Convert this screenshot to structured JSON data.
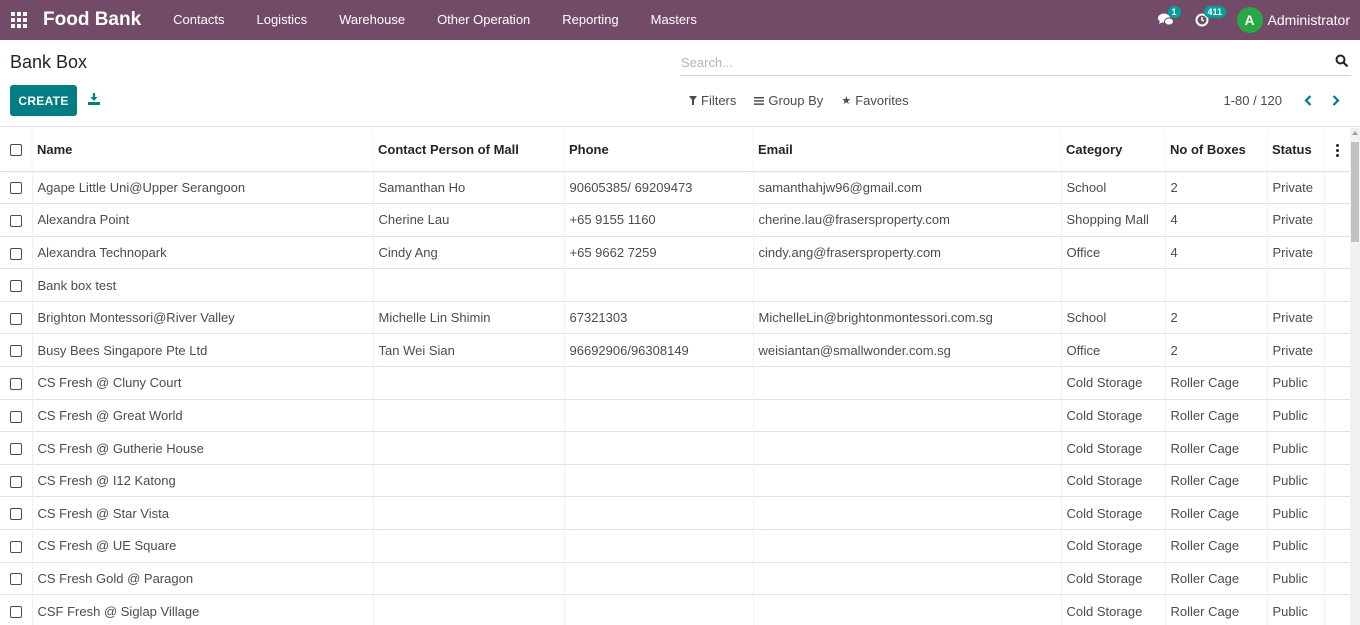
{
  "navbar": {
    "brand": "Food Bank",
    "menu": [
      "Contacts",
      "Logistics",
      "Warehouse",
      "Other Operation",
      "Reporting",
      "Masters"
    ],
    "messages_count": "1",
    "activities_count": "411",
    "avatar_letter": "A",
    "user": "Administrator",
    "bg_color": "#714b67"
  },
  "control": {
    "title": "Bank Box",
    "create_label": "CREATE",
    "search_placeholder": "Search...",
    "filters_label": "Filters",
    "group_by_label": "Group By",
    "favorites_label": "Favorites",
    "pager": "1-80 / 120",
    "accent_color": "#017e84"
  },
  "table": {
    "columns": [
      "Name",
      "Contact Person of Mall",
      "Phone",
      "Email",
      "Category",
      "No of Boxes",
      "Status"
    ],
    "rows": [
      [
        "Agape Little Uni@Upper Serangoon",
        "Samanthan Ho",
        "90605385/ 69209473",
        "samanthahjw96@gmail.com",
        "School",
        "2",
        "Private"
      ],
      [
        "Alexandra Point",
        "Cherine Lau",
        "+65 9155 1160",
        "cherine.lau@frasersproperty.com",
        "Shopping Mall",
        "4",
        "Private"
      ],
      [
        "Alexandra Technopark",
        "Cindy Ang",
        "+65 9662 7259",
        "cindy.ang@frasersproperty.com",
        "Office",
        "4",
        "Private"
      ],
      [
        "Bank box test",
        "",
        "",
        "",
        "",
        "",
        ""
      ],
      [
        "Brighton Montessori@River Valley",
        "Michelle Lin Shimin",
        "67321303",
        "MichelleLin@brightonmontessori.com.sg",
        "School",
        "2",
        "Private"
      ],
      [
        "Busy Bees Singapore Pte Ltd",
        "Tan Wei Sian",
        "96692906/96308149",
        "weisiantan@smallwonder.com.sg",
        "Office",
        "2",
        "Private"
      ],
      [
        "CS Fresh @ Cluny Court",
        "",
        "",
        "",
        "Cold Storage",
        "Roller Cage",
        "Public"
      ],
      [
        "CS Fresh @ Great World",
        "",
        "",
        "",
        "Cold Storage",
        "Roller Cage",
        "Public"
      ],
      [
        "CS Fresh @ Gutherie House",
        "",
        "",
        "",
        "Cold Storage",
        "Roller Cage",
        "Public"
      ],
      [
        "CS Fresh @ I12 Katong",
        "",
        "",
        "",
        "Cold Storage",
        "Roller Cage",
        "Public"
      ],
      [
        "CS Fresh @ Star Vista",
        "",
        "",
        "",
        "Cold Storage",
        "Roller Cage",
        "Public"
      ],
      [
        "CS Fresh @ UE Square",
        "",
        "",
        "",
        "Cold Storage",
        "Roller Cage",
        "Public"
      ],
      [
        "CS Fresh Gold @ Paragon",
        "",
        "",
        "",
        "Cold Storage",
        "Roller Cage",
        "Public"
      ],
      [
        "CSF Fresh @ Siglap Village",
        "",
        "",
        "",
        "Cold Storage",
        "Roller Cage",
        "Public"
      ]
    ]
  }
}
